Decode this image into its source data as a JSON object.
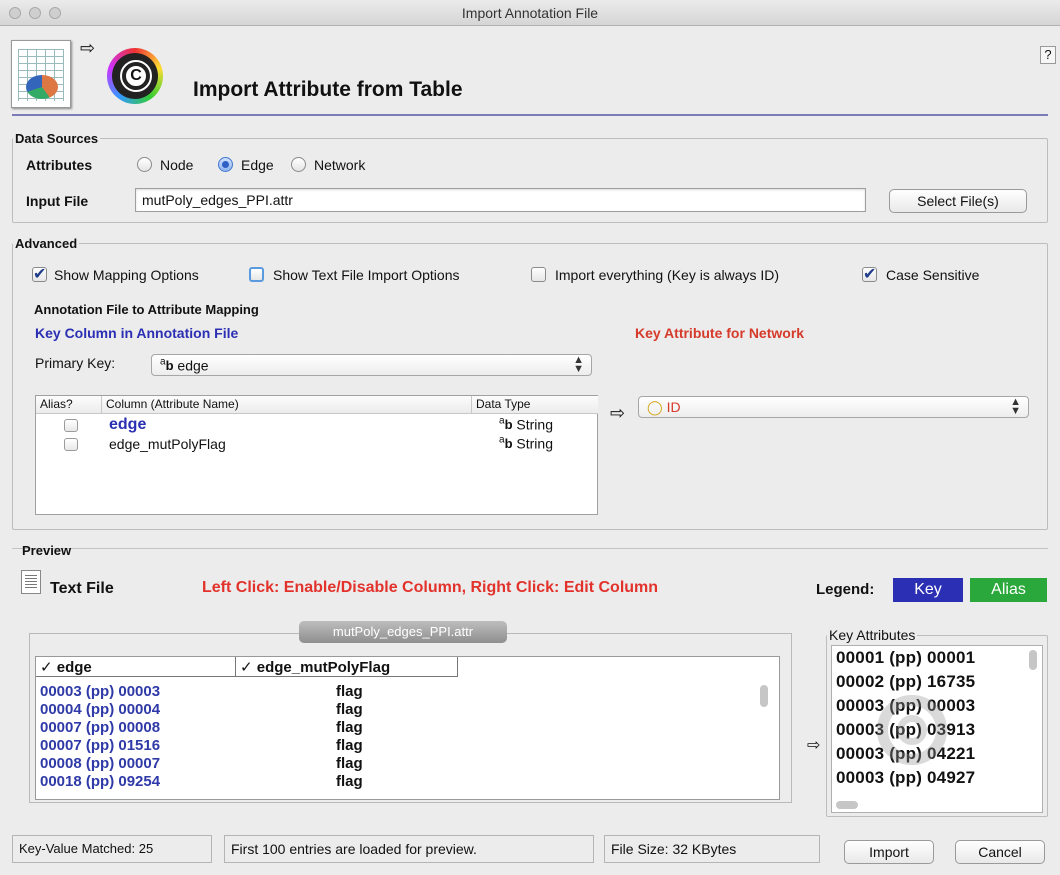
{
  "window": {
    "title": "Import Annotation File"
  },
  "header": {
    "title": "Import Attribute from Table",
    "help_label": "?"
  },
  "data_sources": {
    "group_label": "Data Sources",
    "attributes_label": "Attributes",
    "radio_options": [
      "Node",
      "Edge",
      "Network"
    ],
    "selected": "Edge",
    "input_file_label": "Input File",
    "input_file_value": "mutPoly_edges_PPI.attr",
    "select_files_label": "Select File(s)"
  },
  "advanced": {
    "group_label": "Advanced",
    "options": [
      {
        "label": "Show Mapping Options",
        "checked": true
      },
      {
        "label": "Show Text File Import Options",
        "checked": false
      },
      {
        "label": "Import everything (Key is always ID)",
        "checked": false
      },
      {
        "label": "Case Sensitive",
        "checked": true
      }
    ]
  },
  "mapping": {
    "group_label": "Annotation File to Attribute Mapping",
    "key_column_heading": "Key Column in Annotation File",
    "key_attribute_heading": "Key Attribute for Network",
    "primary_key_label": "Primary Key:",
    "primary_key_value": "edge",
    "key_attribute_value": "ID",
    "table_headers": [
      "Alias?",
      "Column (Attribute Name)",
      "Data Type"
    ],
    "rows": [
      {
        "name": "edge",
        "type": "String",
        "is_key": true
      },
      {
        "name": "edge_mutPolyFlag",
        "type": "String",
        "is_key": false
      }
    ],
    "colors": {
      "key_heading": "#2b2fb3",
      "attr_heading": "#d63a2a"
    }
  },
  "preview": {
    "group_label": "Preview",
    "file_type_label": "Text File",
    "hint": "Left Click: Enable/Disable Column, Right Click: Edit Column",
    "legend_label": "Legend:",
    "legend_key": "Key",
    "legend_alias": "Alias",
    "tab_label": "mutPoly_edges_PPI.attr",
    "columns": [
      "edge",
      "edge_mutPolyFlag"
    ],
    "rows": [
      [
        "00003 (pp) 00003",
        "flag"
      ],
      [
        "00004 (pp) 00004",
        "flag"
      ],
      [
        "00007 (pp) 00008",
        "flag"
      ],
      [
        "00007 (pp) 01516",
        "flag"
      ],
      [
        "00008 (pp) 00007",
        "flag"
      ],
      [
        "00018 (pp) 09254",
        "flag"
      ]
    ],
    "key_attributes_label": "Key Attributes",
    "key_attributes": [
      "00001 (pp) 00001",
      "00002 (pp) 16735",
      "00003 (pp) 00003",
      "00003 (pp) 03913",
      "00003 (pp) 04221",
      "00003 (pp) 04927"
    ]
  },
  "status_bar": {
    "matched": "Key-Value Matched: 25",
    "loaded": "First 100 entries are loaded for preview.",
    "file_size": "File Size: 32 KBytes"
  },
  "footer": {
    "import_label": "Import",
    "cancel_label": "Cancel"
  }
}
